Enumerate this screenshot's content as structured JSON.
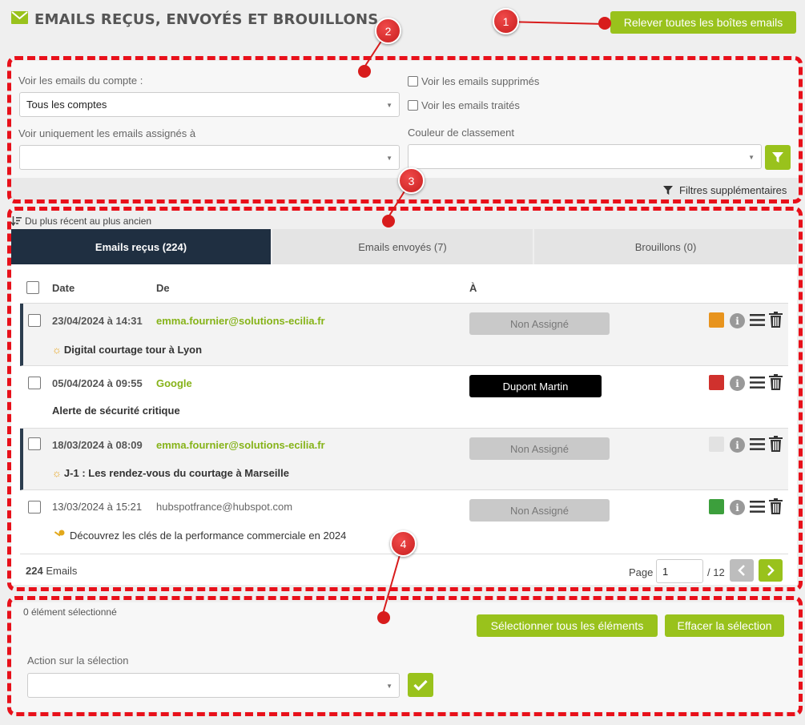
{
  "header": {
    "title": "EMAILS REÇUS, ENVOYÉS ET BROUILLONS",
    "refresh_button": "Relever toutes les boîtes emails"
  },
  "callouts": [
    "1",
    "2",
    "3",
    "4"
  ],
  "filters": {
    "account_label": "Voir les emails du compte :",
    "account_value": "Tous les comptes",
    "assigned_label": "Voir uniquement les emails assignés à",
    "assigned_value": "",
    "deleted_label": "Voir les emails supprimés",
    "processed_label": "Voir les emails traités",
    "color_label": "Couleur de classement",
    "color_value": "",
    "more_filters": "Filtres supplémentaires"
  },
  "sort": {
    "label": "Du plus récent au plus ancien"
  },
  "tabs": [
    {
      "label": "Emails reçus (224)",
      "active": true
    },
    {
      "label": "Emails envoyés (7)",
      "active": false
    },
    {
      "label": "Brouillons (0)",
      "active": false
    }
  ],
  "table": {
    "headers": {
      "date": "Date",
      "from": "De",
      "to": "À"
    },
    "rows": [
      {
        "date": "23/04/2024 à 14:31",
        "from": "emma.fournier@solutions-ecilia.fr",
        "subject": "Digital courtage tour à Lyon",
        "subject_icon": "sun-icon",
        "assign": "Non Assigné",
        "color": "#e8941e",
        "unread": true
      },
      {
        "date": "05/04/2024 à 09:55",
        "from": "Google",
        "subject": "Alerte de sécurité critique",
        "subject_icon": "",
        "assign": "Dupont Martin",
        "color": "#d0312d",
        "unread": false
      },
      {
        "date": "18/03/2024 à 08:09",
        "from": "emma.fournier@solutions-ecilia.fr",
        "subject": "J-1 : Les rendez-vous du courtage à Marseille",
        "subject_icon": "sun-icon",
        "assign": "Non Assigné",
        "color": "#e2e2e2",
        "unread": true
      },
      {
        "date": "13/03/2024 à 15:21",
        "from": "hubspotfrance@hubspot.com",
        "subject": "Découvrez les clés de la performance commerciale en 2024",
        "subject_icon": "key-icon",
        "assign": "Non Assigné",
        "color": "#3c9f3c",
        "unread": false
      }
    ]
  },
  "footer": {
    "count": "224",
    "count_suffix": "Emails",
    "page_label": "Page",
    "page_value": "1",
    "page_total": "/ 12"
  },
  "selection": {
    "count_text": "0 élément sélectionné",
    "select_all": "Sélectionner tous les éléments",
    "clear": "Effacer la sélection",
    "action_label": "Action sur la sélection",
    "action_value": ""
  },
  "colors": {
    "accent": "#99c21c",
    "dark_tab": "#1f2f41",
    "callout": "#d81c1c"
  }
}
